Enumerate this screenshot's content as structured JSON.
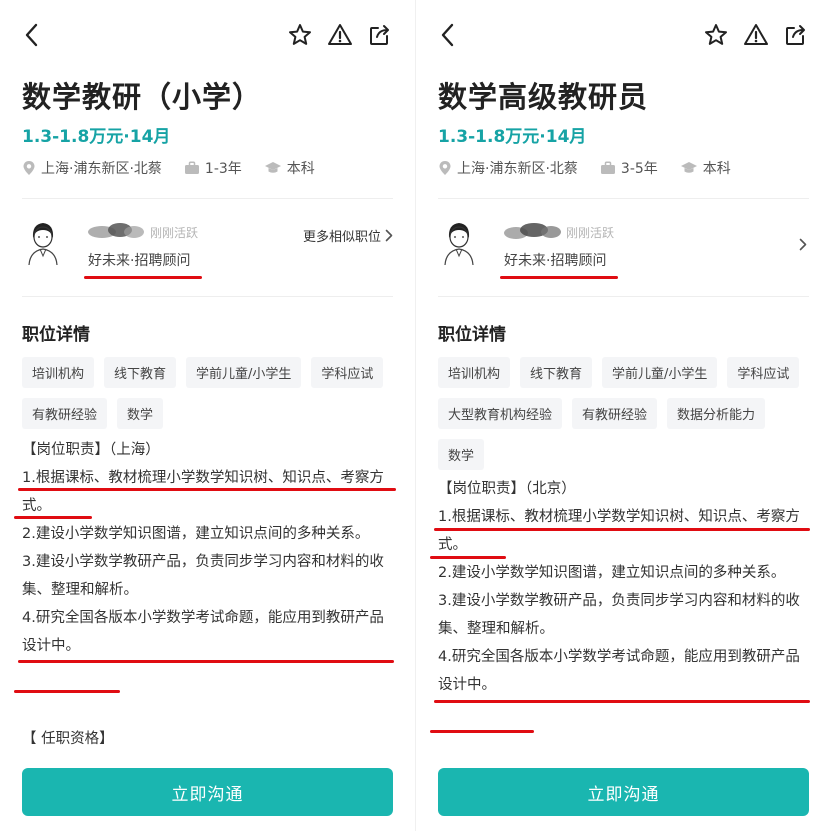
{
  "panels": [
    {
      "title": "数学教研（小学）",
      "salary": "1.3-1.8万元·14月",
      "location": "上海·浦东新区·北蔡",
      "experience": "1-3年",
      "education": "本科",
      "recruiter": {
        "active_status": "刚刚活跃",
        "company": "好未来·招聘顾问",
        "more_link": "更多相似职位"
      },
      "section_title": "职位详情",
      "tags": [
        "培训机构",
        "线下教育",
        "学前儿童/小学生",
        "学科应试",
        "有教研经验",
        "数学"
      ],
      "duty_heading": "【岗位职责】（上海）",
      "duties": [
        "1.根据课标、教材梳理小学数学知识树、知识点、考察方式。",
        "2.建设小学数学知识图谱，建立知识点间的多种关系。",
        "3.建设小学数学教研产品，负责同步学习内容和材料的收集、整理和解析。",
        "4.研究全国各版本小学数学考试命题，能应用到教研产品设计中。"
      ],
      "qualification_heading": "【 任职资格】",
      "cta": "立即沟通"
    },
    {
      "title": "数学高级教研员",
      "salary": "1.3-1.8万元·14月",
      "location": "上海·浦东新区·北蔡",
      "experience": "3-5年",
      "education": "本科",
      "recruiter": {
        "active_status": "刚刚活跃",
        "company": "好未来·招聘顾问"
      },
      "section_title": "职位详情",
      "tags": [
        "培训机构",
        "线下教育",
        "学前儿童/小学生",
        "学科应试",
        "大型教育机构经验",
        "有教研经验",
        "数据分析能力",
        "数学"
      ],
      "duty_heading": "【岗位职责】（北京）",
      "duties": [
        "1.根据课标、教材梳理小学数学知识树、知识点、考察方式。",
        "2.建设小学数学知识图谱，建立知识点间的多种关系。",
        "3.建设小学数学教研产品，负责同步学习内容和材料的收集、整理和解析。",
        "4.研究全国各版本小学数学考试命题，能应用到教研产品设计中。"
      ],
      "cta": "立即沟通"
    }
  ],
  "icons": {
    "back": "chevron-left-icon",
    "favorite": "star-icon",
    "report": "warning-icon",
    "share": "share-icon",
    "location": "location-pin-icon",
    "experience": "briefcase-icon",
    "education": "graduation-cap-icon"
  },
  "colors": {
    "accent": "#16a3a5",
    "button": "#1ab6b0",
    "annotation": "#e00c12",
    "tag_bg": "#f4f5f7"
  }
}
